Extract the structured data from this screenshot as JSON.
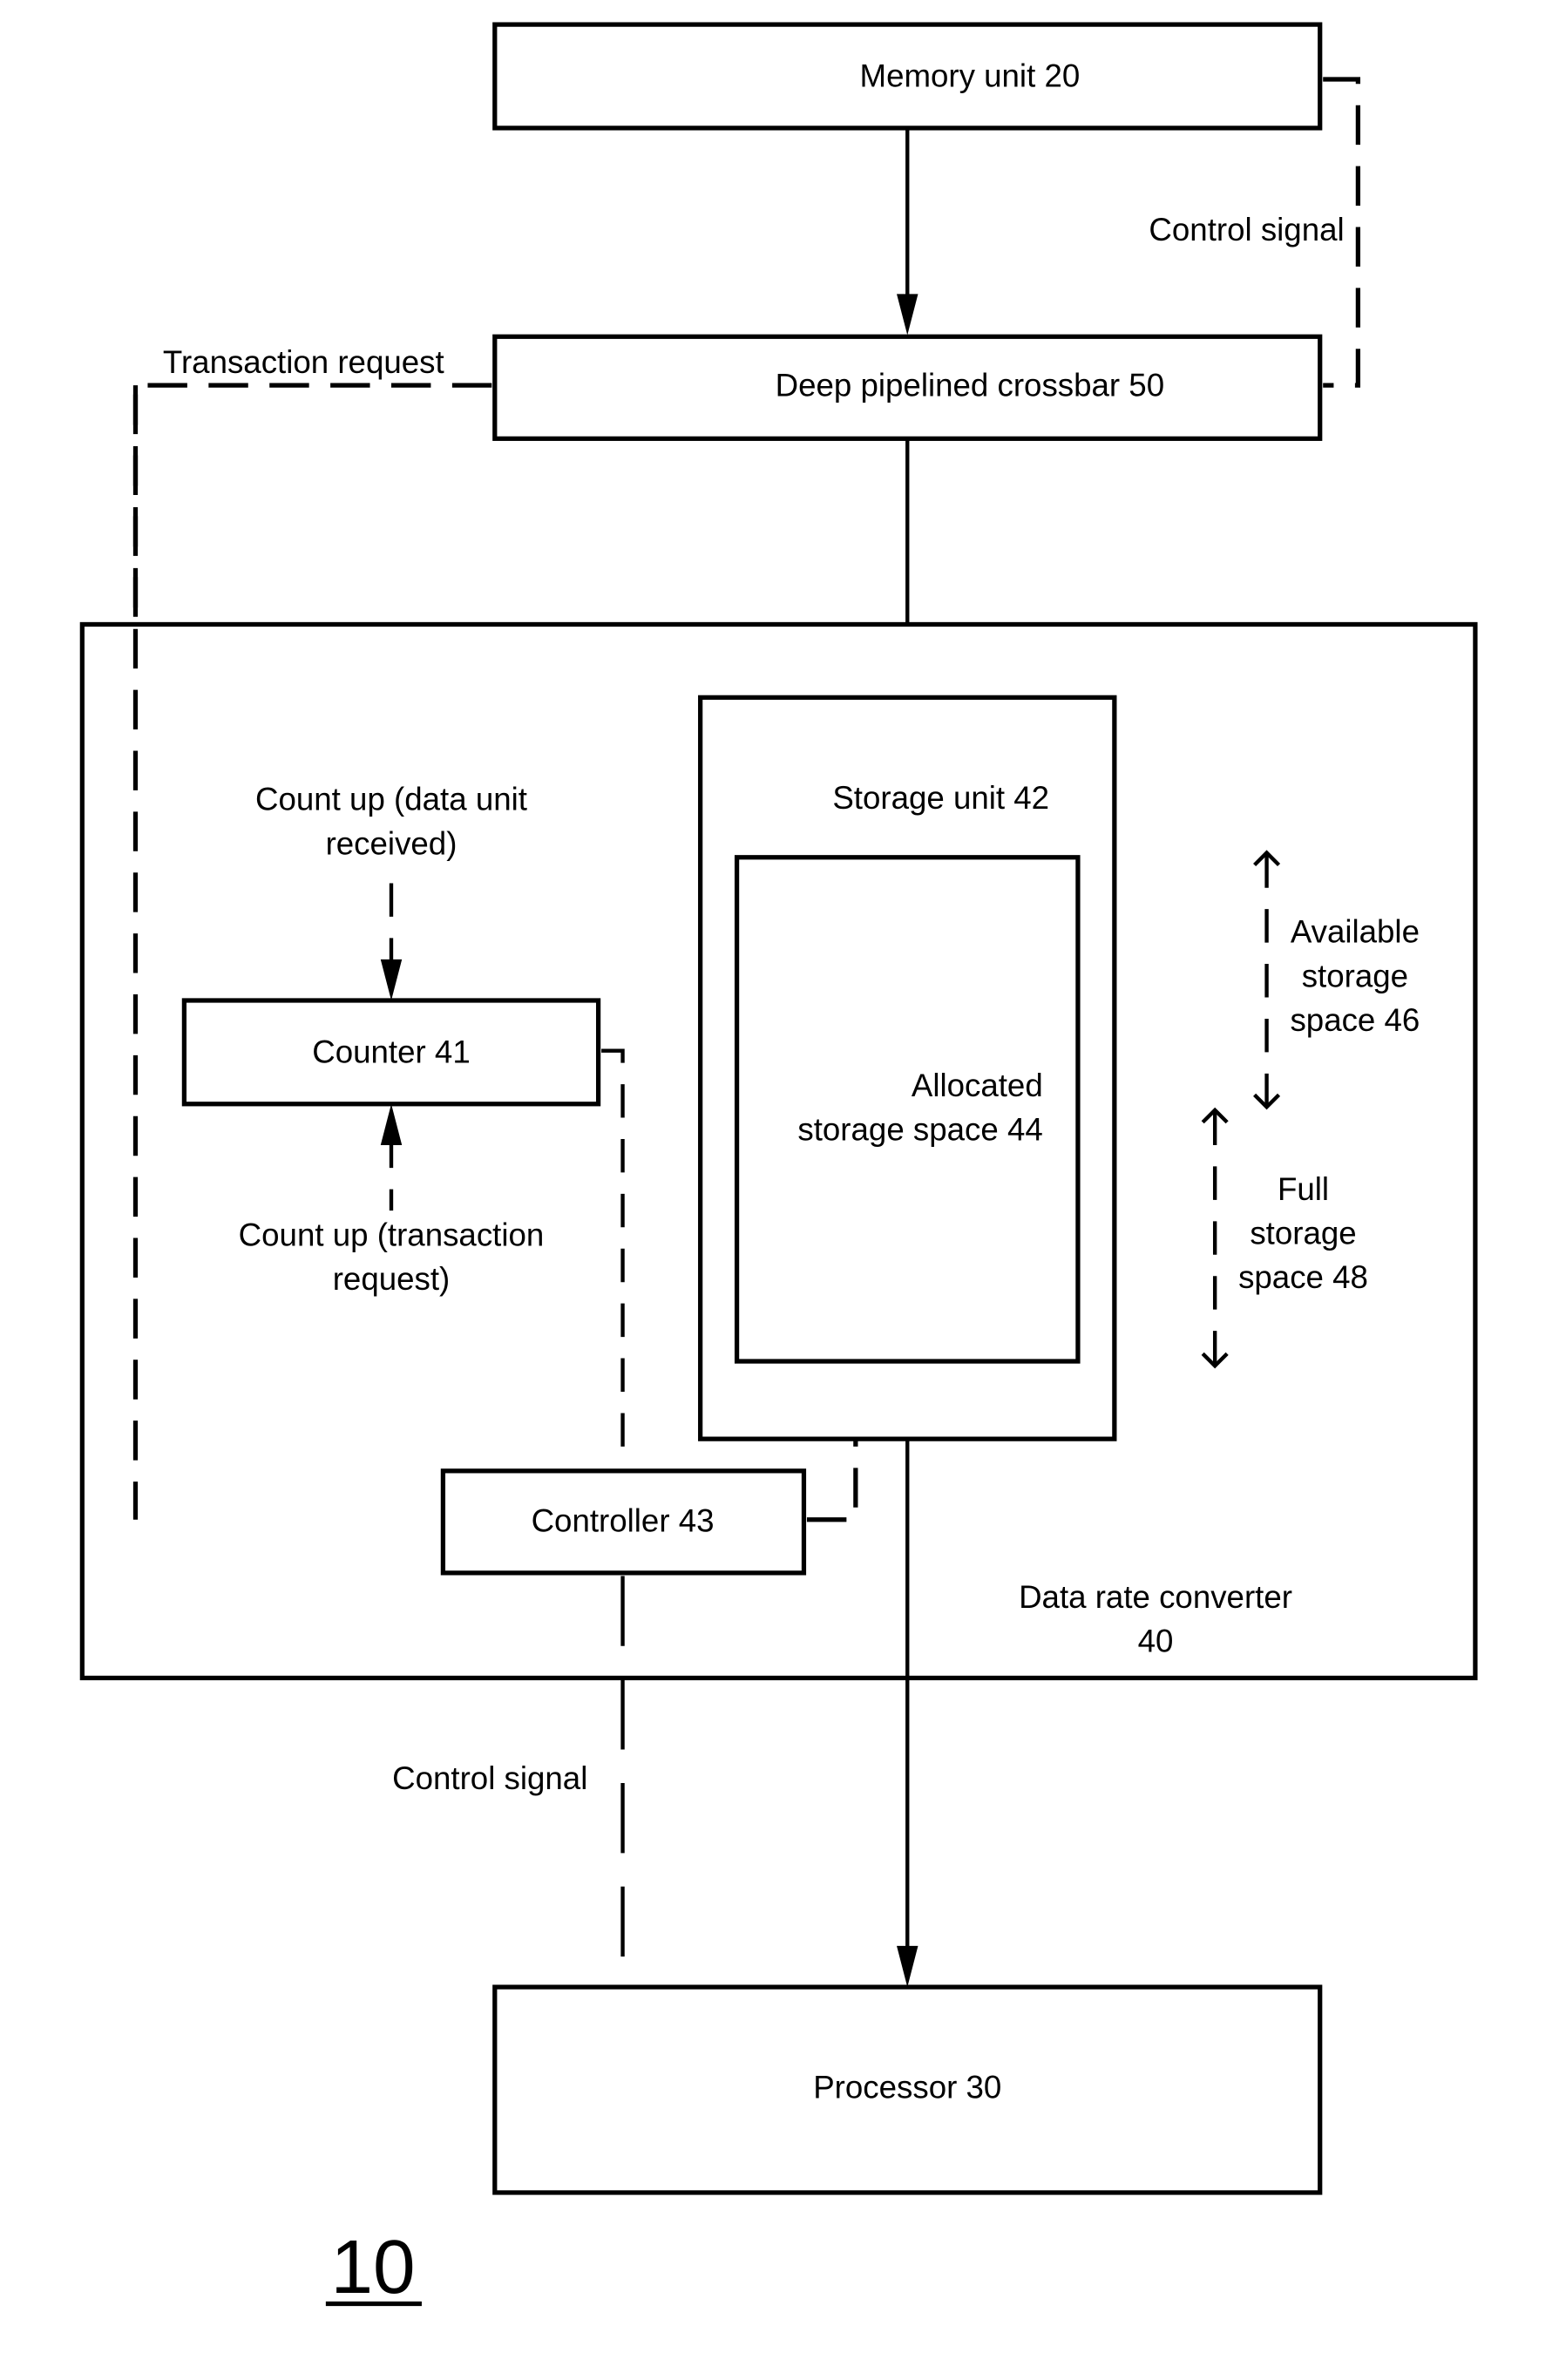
{
  "figure": {
    "number": "10",
    "blocks": {
      "memory_unit": "Memory unit 20",
      "crossbar": "Deep pipelined crossbar  50",
      "data_rate_converter": [
        "Data rate converter",
        "40"
      ],
      "storage_unit": "Storage unit 42",
      "allocated_storage": [
        "Allocated",
        "storage space 44"
      ],
      "counter": "Counter 41",
      "controller": "Controller 43",
      "processor": "Processor 30"
    },
    "labels": {
      "control_signal_top": "Control signal",
      "transaction_request": "Transaction request",
      "count_up_data": [
        "Count up (data unit",
        "received)"
      ],
      "count_up_transaction": [
        "Count up (transaction",
        "request)"
      ],
      "available_storage": [
        "Available",
        "storage",
        "space 46"
      ],
      "full_storage": [
        "Full",
        "storage",
        "space 48"
      ],
      "control_signal_bottom": "Control signal"
    }
  }
}
